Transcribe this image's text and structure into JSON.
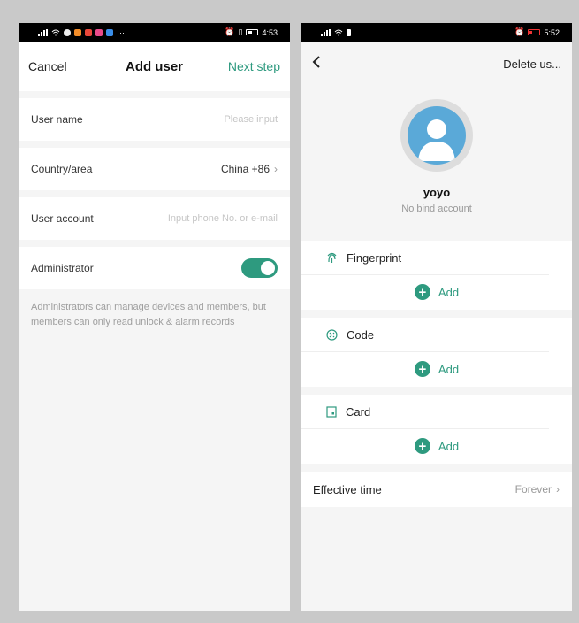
{
  "left_screen": {
    "status_bar": {
      "time": "4:53",
      "more": "···"
    },
    "nav": {
      "cancel_label": "Cancel",
      "title": "Add user",
      "next_label": "Next step"
    },
    "fields": {
      "user_name": {
        "label": "User name",
        "placeholder": "Please input"
      },
      "country": {
        "label": "Country/area",
        "value": "China +86"
      },
      "user_account": {
        "label": "User account",
        "placeholder": "Input phone No. or e-mail"
      },
      "administrator": {
        "label": "Administrator",
        "enabled": true
      }
    },
    "note": "Administrators can manage devices and members, but members can only read unlock & alarm records"
  },
  "right_screen": {
    "status_bar": {
      "time": "5:52"
    },
    "nav": {
      "back_icon": "chevron-left-icon",
      "delete_label": "Delete us..."
    },
    "profile": {
      "name": "yoyo",
      "bind_status": "No bind account"
    },
    "sections": [
      {
        "icon": "fingerprint-icon",
        "label": "Fingerprint",
        "add_label": "Add"
      },
      {
        "icon": "keypad-icon",
        "label": "Code",
        "add_label": "Add"
      },
      {
        "icon": "card-icon",
        "label": "Card",
        "add_label": "Add"
      }
    ],
    "effective_time": {
      "label": "Effective time",
      "value": "Forever"
    }
  },
  "colors": {
    "accent": "#2e9a7f",
    "avatar_bg": "#5aa9d8",
    "background": "#f5f5f5"
  }
}
